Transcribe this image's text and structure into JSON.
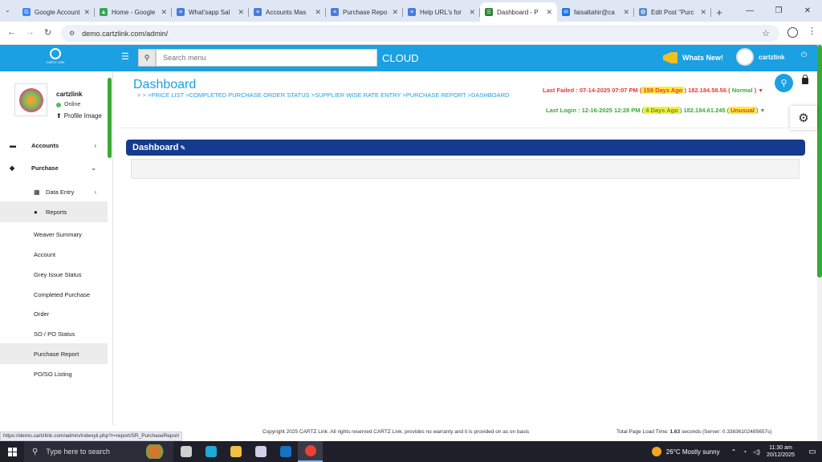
{
  "browser": {
    "tabs": [
      {
        "title": "Google Account",
        "color": "#4285f4",
        "glyph": "G"
      },
      {
        "title": "Home - Google",
        "color": "#34a853",
        "glyph": "▲"
      },
      {
        "title": "What'sapp Sal",
        "color": "#4a7bd8",
        "glyph": "≡"
      },
      {
        "title": "Accounts Mas",
        "color": "#4a7bd8",
        "glyph": "≡"
      },
      {
        "title": "Purchase Repo",
        "color": "#4a7bd8",
        "glyph": "≡"
      },
      {
        "title": "Help URL's for",
        "color": "#4a7bd8",
        "glyph": "≡"
      },
      {
        "title": "Dashboard - P",
        "color": "#2e7d32",
        "glyph": "☰",
        "active": true
      },
      {
        "title": "faisaltahir@ca",
        "color": "#1a73e8",
        "glyph": "✉"
      },
      {
        "title": "Edit Post \"Purc",
        "color": "#5a8fc8",
        "glyph": "✿"
      }
    ],
    "url": "demo.cartzlink.com/admin/"
  },
  "header": {
    "logo_text": "CARTZ LINK",
    "search_placeholder": "Search menu",
    "cloud_label": "CLOUD",
    "whats_new": "Whats New!",
    "username": "cartzlink"
  },
  "sidebar": {
    "user_name": "cartzlink",
    "status": "Online",
    "profile_label": "Profile Image",
    "items": [
      {
        "label": "Accounts",
        "icon": "▬"
      },
      {
        "label": "Purchase",
        "icon": "◆"
      }
    ],
    "purchase_sub": [
      {
        "label": "Data Entry",
        "icon": "▦"
      },
      {
        "label": "Reports",
        "icon": "●"
      }
    ],
    "reports": [
      "Weaver Summary",
      "Account",
      "Grey Issue Status",
      "Completed Purchase",
      "Order",
      "SO / PO Status",
      "Purchase Report",
      "PO/SO Listing"
    ]
  },
  "main": {
    "title": "Dashboard",
    "breadcrumbs": [
      ">PRICE LIST",
      ">COMPLETED PURCHASE ORDER STATUS",
      ">SUPPLIER WISE RATE ENTRY",
      ">PURCHASE REPORT",
      ">DASHBOARD"
    ],
    "last_failed": {
      "label": "Last Failed : 07-14-2025 07:07 PM (",
      "ago": " 159 Days Ago ",
      "ip": ") 182.184.58.56 (",
      "status": " Normal ",
      "end": ")"
    },
    "last_login": {
      "label": "Last Login : 12-16-2025 12:28 PM (",
      "ago": " 4 Days Ago ",
      "ip": ") 182.184.61.245 (",
      "status": " Unusual ",
      "end": ")"
    },
    "panel_title": "Dashboard"
  },
  "footer": {
    "copyright": "Copyright 2025 CARTZ Link. All rights reserved CARTZ Link. provides no warranty and it is provided on as on basis",
    "load_label": "Total Page Load Time: ",
    "load_value": "1.63",
    "load_suffix": " seconds (Server: 0.33836102485657s)",
    "status_url": "https://demo.cartzlink.com/admin/indexyii.php?r=report/SR_PurchaseReport"
  },
  "taskbar": {
    "search_placeholder": "Type here to search",
    "weather": "26°C  Mostly sunny",
    "time": "11:30 am",
    "date": "20/12/2025",
    "apps": [
      {
        "name": "task-view",
        "color": "#d0d0d0"
      },
      {
        "name": "edge",
        "color": "#1fa8d8"
      },
      {
        "name": "file-explorer",
        "color": "#f0c040"
      },
      {
        "name": "store",
        "color": "#d0d0e8"
      },
      {
        "name": "outlook",
        "color": "#1572c4"
      },
      {
        "name": "chrome",
        "color": "#e94235",
        "active": true
      }
    ]
  }
}
